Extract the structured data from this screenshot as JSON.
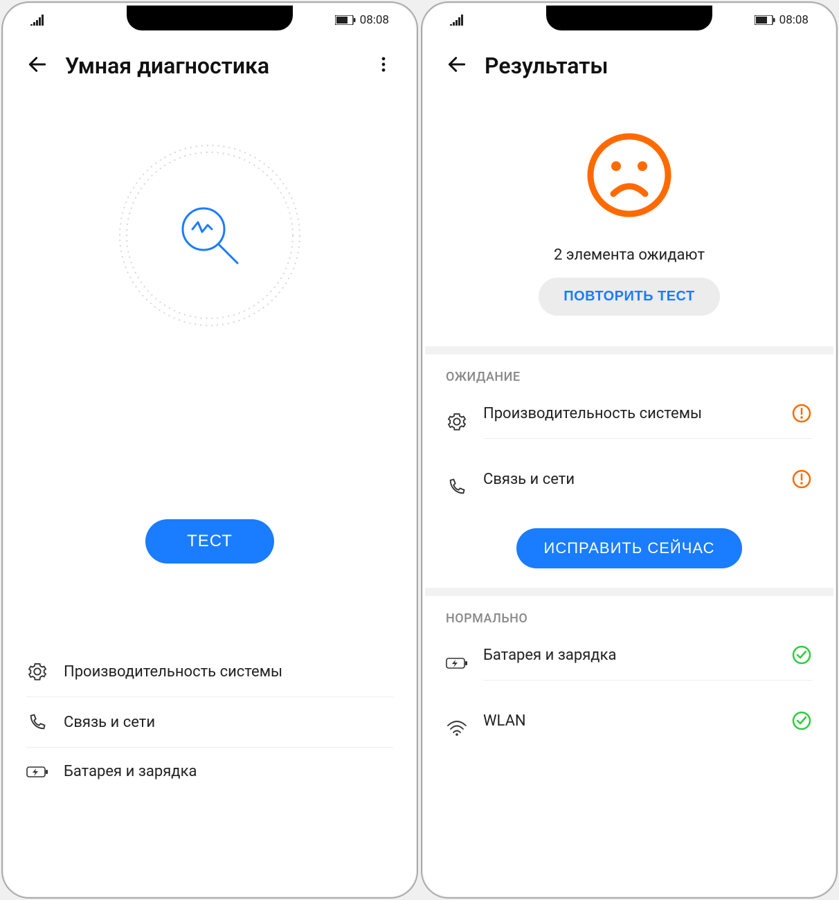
{
  "status": {
    "time": "08:08"
  },
  "colors": {
    "accent": "#1a7cff",
    "warn": "#ff6a00",
    "ok": "#2ecc40"
  },
  "left": {
    "title": "Умная диагностика",
    "test_button": "ТЕСТ",
    "items": [
      {
        "label": "Производительность системы",
        "icon": "gear"
      },
      {
        "label": "Связь и сети",
        "icon": "phone"
      },
      {
        "label": "Батарея и зарядка",
        "icon": "battery"
      }
    ]
  },
  "right": {
    "title": "Результаты",
    "summary": "2 элемента ожидают",
    "retry_button": "ПОВТОРИТЬ ТЕСТ",
    "fix_button": "ИСПРАВИТЬ СЕЙЧАС",
    "sections": {
      "pending": {
        "title": "ОЖИДАНИЕ",
        "items": [
          {
            "label": "Производительность системы",
            "icon": "gear",
            "status": "warn"
          },
          {
            "label": "Связь и сети",
            "icon": "phone",
            "status": "warn"
          }
        ]
      },
      "normal": {
        "title": "НОРМАЛЬНО",
        "items": [
          {
            "label": "Батарея и зарядка",
            "icon": "battery",
            "status": "ok"
          },
          {
            "label": "WLAN",
            "icon": "wifi",
            "status": "ok"
          }
        ]
      }
    }
  }
}
